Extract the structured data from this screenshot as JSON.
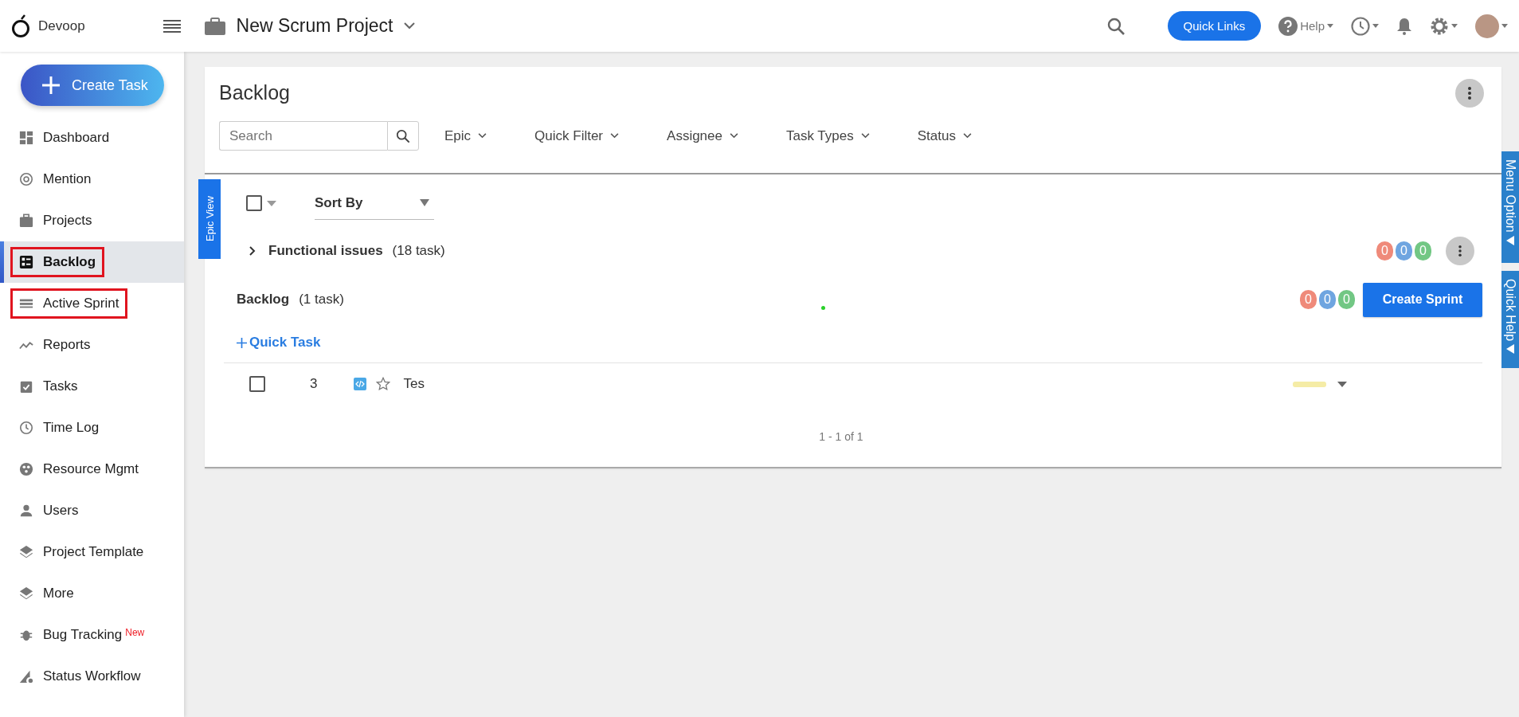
{
  "topbar": {
    "logo": "Devoop",
    "project": "New Scrum Project",
    "quick_links": "Quick Links",
    "help": "Help"
  },
  "sidebar": {
    "create_task": "Create Task",
    "items": [
      {
        "label": "Dashboard",
        "selected": false,
        "highlighted": false
      },
      {
        "label": "Mention",
        "selected": false,
        "highlighted": false
      },
      {
        "label": "Projects",
        "selected": false,
        "highlighted": false
      },
      {
        "label": "Backlog",
        "selected": true,
        "highlighted": true
      },
      {
        "label": "Active Sprint",
        "selected": false,
        "highlighted": true
      },
      {
        "label": "Reports",
        "selected": false,
        "highlighted": false
      },
      {
        "label": "Tasks",
        "selected": false,
        "highlighted": false
      },
      {
        "label": "Time Log",
        "selected": false,
        "highlighted": false
      },
      {
        "label": "Resource Mgmt",
        "selected": false,
        "highlighted": false
      },
      {
        "label": "Users",
        "selected": false,
        "highlighted": false
      },
      {
        "label": "Project Template",
        "selected": false,
        "highlighted": false
      },
      {
        "label": "More",
        "selected": false,
        "highlighted": false
      },
      {
        "label": "Bug Tracking",
        "badge": "New",
        "selected": false,
        "highlighted": false
      },
      {
        "label": "Status Workflow",
        "selected": false,
        "highlighted": false
      }
    ]
  },
  "page": {
    "title": "Backlog",
    "search": {
      "placeholder": "Search"
    },
    "filters": [
      "Epic",
      "Quick Filter",
      "Assignee",
      "Task Types",
      "Status"
    ],
    "epic_view_tab": "Epic View",
    "select_all": {
      "checked": false
    },
    "sort": {
      "label": "Sort By"
    },
    "groups": [
      {
        "name": "Functional issues",
        "count": "(18 task)",
        "expanded": false,
        "counters": [
          {
            "value": "0",
            "color": "#ef8a7a"
          },
          {
            "value": "0",
            "color": "#6fa5e0"
          },
          {
            "value": "0",
            "color": "#72c784"
          }
        ]
      }
    ],
    "backlog": {
      "name": "Backlog",
      "count": "(1 task)",
      "counters": [
        {
          "value": "0",
          "color": "#ef8a7a"
        },
        {
          "value": "0",
          "color": "#6fa5e0"
        },
        {
          "value": "0",
          "color": "#72c784"
        }
      ],
      "create_sprint": "Create Sprint",
      "quick_task": "Quick Task",
      "tasks": [
        {
          "checked": false,
          "id": "3",
          "starred": false,
          "title": "Tes"
        }
      ]
    },
    "pagination": "1 - 1 of 1"
  },
  "side_tabs": [
    "Menu Option",
    "Quick Help"
  ]
}
